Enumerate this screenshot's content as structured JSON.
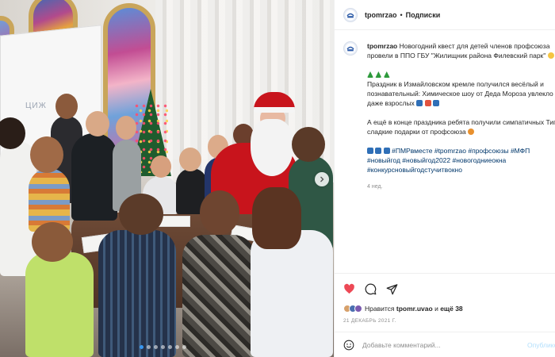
{
  "post": {
    "username": "tpomrzao",
    "header_separator": "•",
    "follow_label": "Подписки"
  },
  "caption": {
    "username": "tpomrzao",
    "intro": "Новогодний квест для детей членов профсоюза провели в ППО ГБУ \"Жилищник района Филевский парк\"",
    "p1_line1": "Праздник в Измайловском кремле получился весёлый и",
    "p1_line2": "познавательный: Химическое шоу от Деда Мороза увлекло",
    "p1_line3": "даже взрослых",
    "p2_line1": "А ещё в конце праздника ребята получили симпатичных Тигрят и",
    "p2_line2": "сладкие подарки от профсоюза",
    "hashtags": "#ПМРвместе #tpomrzao #профсоюзы #МФП #новыйгод #новыйгод2022 #новогодниеокна #конкурсновыйгодстучитвокно",
    "time_ago": "4 нед."
  },
  "likes": {
    "prefix": "Нравится",
    "user": "tpomr.uvao",
    "connector": "и",
    "others": "ещё 38"
  },
  "date": "21 ДЕКАБРЬ 2021 Г.",
  "comment": {
    "placeholder": "Добавьте комментарий...",
    "publish_label": "Опубликовать"
  },
  "photo": {
    "screen_text": "ЦИЖ",
    "carousel_count": 7,
    "carousel_active": 1
  },
  "colors": {
    "link": "#00376b",
    "like_red": "#ed4956",
    "publish_disabled": "#b2dffc",
    "meta_gray": "#8e8e8e"
  },
  "icons": [
    "heart-icon",
    "comment-icon",
    "share-icon",
    "emoji-icon",
    "chevron-right-icon",
    "tree-emoji-icon",
    "snowflake-emoji-icon",
    "gift-emoji-icon",
    "tiger-emoji-icon"
  ]
}
